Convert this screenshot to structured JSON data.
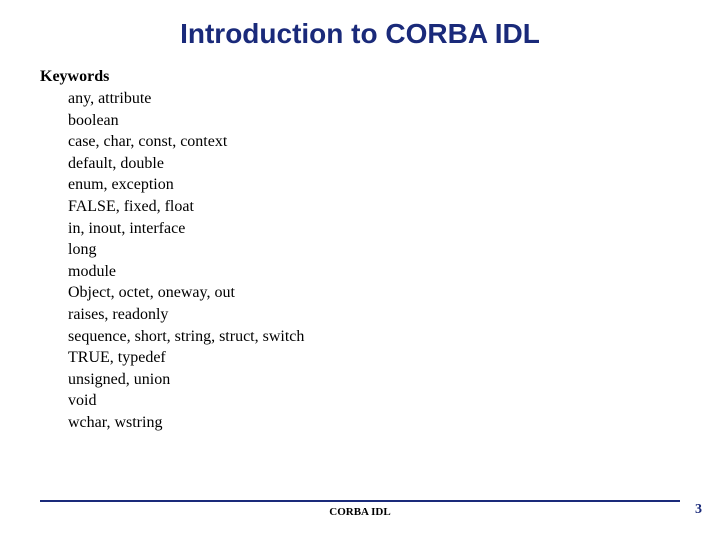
{
  "title": "Introduction to CORBA IDL",
  "section_label": "Keywords",
  "keywords": [
    "any, attribute",
    "boolean",
    "case, char, const, context",
    "default, double",
    "enum, exception",
    "FALSE, fixed, float",
    "in, inout, interface",
    "long",
    "module",
    "Object, octet, oneway, out",
    "raises, readonly",
    "sequence, short, string, struct, switch",
    "TRUE, typedef",
    "unsigned, union",
    "void",
    "wchar, wstring"
  ],
  "footer": {
    "label": "CORBA IDL",
    "page_number": "3"
  }
}
